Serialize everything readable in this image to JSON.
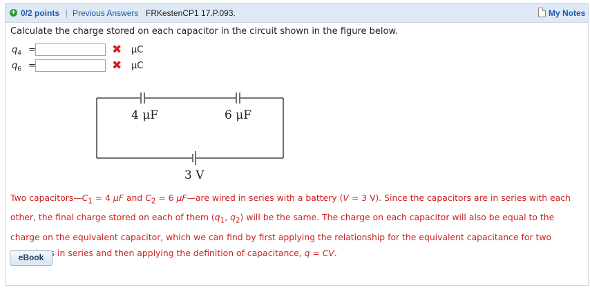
{
  "header": {
    "points": "0/2 points",
    "separator": "|",
    "previous_answers": "Previous Answers",
    "question_id": "FRKestenCP1 17.P.093.",
    "my_notes": "My Notes"
  },
  "question": {
    "prompt": "Calculate the charge stored on each capacitor in the circuit shown in the figure below.",
    "answers": [
      {
        "var": "q",
        "sub": "4",
        "value": "",
        "unit": "μC",
        "status": "incorrect"
      },
      {
        "var": "q",
        "sub": "6",
        "value": "",
        "unit": "μC",
        "status": "incorrect"
      }
    ]
  },
  "figure": {
    "cap1_label": "4 μF",
    "cap2_label": "6 μF",
    "battery_label": "3 V"
  },
  "explanation": {
    "p1": "Two capacitors—",
    "c1": "C",
    "c1_sub": "1",
    "p2": " = 4 ",
    "uf1": "μF",
    "p3": " and ",
    "c2": "C",
    "c2_sub": "2",
    "p4": " = 6 ",
    "uf2": "μF",
    "p5": "—are wired in series with a battery (",
    "v": "V",
    "p6": " = 3 V). Since the capacitors are in series with each other, the final charge stored on each of them (",
    "q1": "q",
    "q1_sub": "1",
    "p7": ", ",
    "q2": "q",
    "q2_sub": "2",
    "p8": ") will be the same. The charge on each capacitor will also be equal to the charge on the equivalent capacitor, which we can find by first applying the relationship for the equivalent capacitance for two capacitors in series and then applying the definition of capacitance, ",
    "formula": "q = CV",
    "p9": "."
  },
  "ebook_label": "eBook",
  "colors": {
    "header_bg": "#dfe9f5",
    "link": "#1d5aa6",
    "error": "#cc1f1f",
    "x_mark": "#d32020"
  }
}
